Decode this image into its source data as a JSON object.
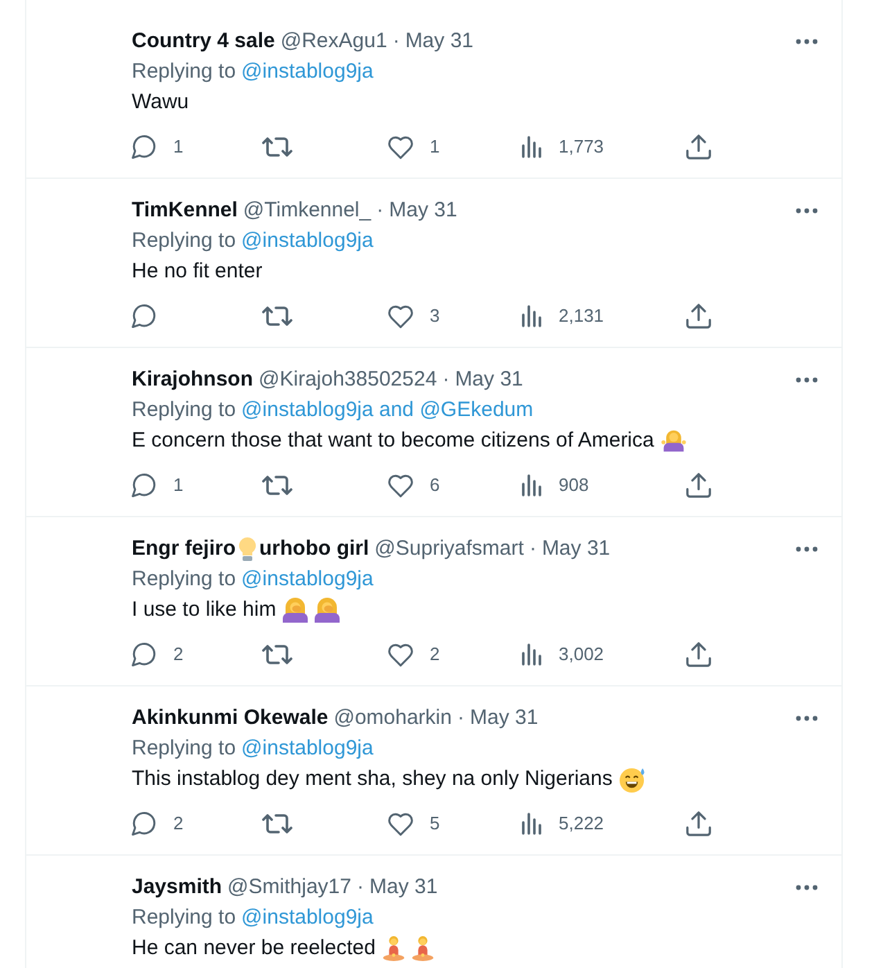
{
  "tweets": [
    {
      "name": [
        {
          "kind": "text",
          "text": "Country 4 sale"
        }
      ],
      "handle": "@RexAgu1",
      "separator": "·",
      "date": "May 31",
      "replying": {
        "label": "Replying to",
        "mention": "@instablog9ja"
      },
      "body": [
        {
          "kind": "text",
          "text": "Wawu"
        }
      ],
      "actions": [
        {
          "kind": "reply",
          "count": "1"
        },
        {
          "kind": "retweet"
        },
        {
          "kind": "like",
          "count": "1"
        },
        {
          "kind": "views",
          "count": "1,773"
        },
        {
          "kind": "share"
        }
      ]
    },
    {
      "name": [
        {
          "kind": "text",
          "text": "TimKennel"
        }
      ],
      "handle": "@Timkennel_",
      "separator": "·",
      "date": "May 31",
      "replying": {
        "label": "Replying to",
        "mention": "@instablog9ja"
      },
      "body": [
        {
          "kind": "text",
          "text": "He no fit enter"
        }
      ],
      "actions": [
        {
          "kind": "reply"
        },
        {
          "kind": "retweet"
        },
        {
          "kind": "like",
          "count": "3"
        },
        {
          "kind": "views",
          "count": "2,131"
        },
        {
          "kind": "share"
        }
      ]
    },
    {
      "name": [
        {
          "kind": "text",
          "text": "Kirajohnson"
        }
      ],
      "handle": "@Kirajoh38502524",
      "separator": "·",
      "date": "May 31",
      "replying": {
        "label": "Replying to",
        "mention": "@instablog9ja and @GEkedum"
      },
      "body": [
        {
          "kind": "text",
          "text": "E concern those that want to become citizens of America"
        },
        {
          "kind": "shrug"
        }
      ],
      "actions": [
        {
          "kind": "reply",
          "count": "1"
        },
        {
          "kind": "retweet"
        },
        {
          "kind": "like",
          "count": "6"
        },
        {
          "kind": "views",
          "count": "908"
        },
        {
          "kind": "share"
        }
      ]
    },
    {
      "name": [
        {
          "kind": "text",
          "text": "Engr fejiro"
        },
        {
          "kind": "lightbulb"
        },
        {
          "kind": "text",
          "text": "urhobo girl"
        }
      ],
      "handle": "@Supriyafsmart",
      "separator": "·",
      "date": "May 31",
      "replying": {
        "label": "Replying to",
        "mention": "@instablog9ja"
      },
      "body": [
        {
          "kind": "text",
          "text": "I use to like him"
        },
        {
          "kind": "facepalm"
        },
        {
          "kind": "facepalm"
        }
      ],
      "actions": [
        {
          "kind": "reply",
          "count": "2"
        },
        {
          "kind": "retweet"
        },
        {
          "kind": "like",
          "count": "2"
        },
        {
          "kind": "views",
          "count": "3,002"
        },
        {
          "kind": "share"
        }
      ]
    },
    {
      "name": [
        {
          "kind": "text",
          "text": "Akinkunmi Okewale"
        }
      ],
      "handle": "@omoharkin",
      "separator": "·",
      "date": "May 31",
      "replying": {
        "label": "Replying to",
        "mention": "@instablog9ja"
      },
      "body": [
        {
          "kind": "text",
          "text": "This instablog dey ment sha, shey na only Nigerians"
        },
        {
          "kind": "sweatsmile"
        }
      ],
      "actions": [
        {
          "kind": "reply",
          "count": "2"
        },
        {
          "kind": "retweet"
        },
        {
          "kind": "like",
          "count": "5"
        },
        {
          "kind": "views",
          "count": "5,222"
        },
        {
          "kind": "share"
        }
      ]
    },
    {
      "name": [
        {
          "kind": "text",
          "text": "Jaysmith"
        }
      ],
      "handle": "@Smithjay17",
      "separator": "·",
      "date": "May 31",
      "replying": {
        "label": "Replying to",
        "mention": "@instablog9ja"
      },
      "body": [
        {
          "kind": "text",
          "text": "He can never be reelected"
        },
        {
          "kind": "lotus"
        },
        {
          "kind": "lotus"
        }
      ]
    }
  ]
}
